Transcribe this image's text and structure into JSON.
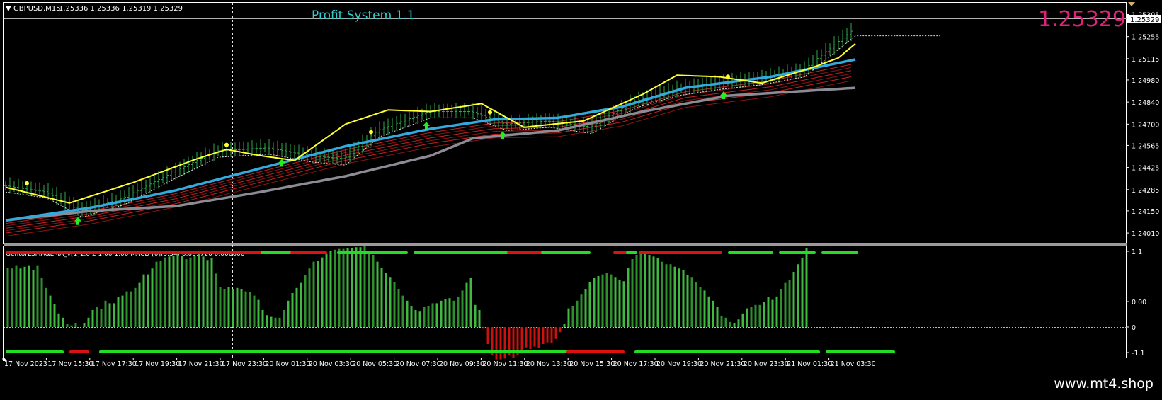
{
  "main_header": {
    "symbol_label": "GBPUSD,M15",
    "ohlc": "1.25336 1.25336 1.25319 1.25329"
  },
  "overlay_title": "Profit System 1.1",
  "big_price": "1.25329",
  "current_price_tag": "1.25329",
  "price_axis_labels": [
    "1.25395",
    "1.25255",
    "1.25115",
    "1.24980",
    "1.24840",
    "1.24700",
    "1.24565",
    "1.24425",
    "1.24285",
    "1.24150",
    "1.24010"
  ],
  "indicator_header": "GentorLSMA&EMA_v[1]1.0.2 1.00 1.00 MACD [0](5,34) 0.001720 0.000000",
  "indicator_axis_labels": [
    "1.1",
    "0.00",
    "0",
    "-1.1"
  ],
  "time_labels": [
    "17 Nov 2023",
    "17 Nov 15:30",
    "17 Nov 17:30",
    "17 Nov 19:30",
    "17 Nov 21:30",
    "17 Nov 23:30",
    "20 Nov 01:30",
    "20 Nov 03:30",
    "20 Nov 05:30",
    "20 Nov 07:30",
    "20 Nov 09:30",
    "20 Nov 11:30",
    "20 Nov 13:30",
    "20 Nov 15:30",
    "20 Nov 17:30",
    "20 Nov 19:30",
    "20 Nov 21:30",
    "20 Nov 23:30",
    "21 Nov 01:30",
    "21 Nov 03:30"
  ],
  "watermark": "www.mt4.shop",
  "colors": {
    "price_bars": "#2fa84f",
    "yellow_line": "#ffff33",
    "blue_line": "#33aadd",
    "slow_line": "#8c8c96",
    "ribbon": "#b42020",
    "arrow": "#22ee22",
    "macd_up": "#3fb93f",
    "macd_down": "#cc1111",
    "title": "#33cccc",
    "big_price": "#e0207a",
    "grid": "#ffffff"
  },
  "chart_data": {
    "type": "line",
    "symbol": "GBPUSD",
    "timeframe": "M15",
    "y_range": [
      1.2397,
      1.2546
    ],
    "bars": 200,
    "price_path": [
      [
        0,
        1.2431
      ],
      [
        10,
        1.2427
      ],
      [
        18,
        1.2415
      ],
      [
        28,
        1.2423
      ],
      [
        38,
        1.2437
      ],
      [
        50,
        1.2453
      ],
      [
        62,
        1.2455
      ],
      [
        72,
        1.245
      ],
      [
        80,
        1.2448
      ],
      [
        88,
        1.2466
      ],
      [
        100,
        1.2478
      ],
      [
        110,
        1.2478
      ],
      [
        118,
        1.247
      ],
      [
        128,
        1.2472
      ],
      [
        138,
        1.2468
      ],
      [
        148,
        1.2484
      ],
      [
        158,
        1.2492
      ],
      [
        168,
        1.2496
      ],
      [
        178,
        1.2499
      ],
      [
        188,
        1.2504
      ],
      [
        200,
        1.253
      ]
    ],
    "series": [
      {
        "name": "",
        "role": "fast",
        "values": [
          [
            0,
            1.243
          ],
          [
            15,
            1.242
          ],
          [
            30,
            1.2433
          ],
          [
            45,
            1.2448
          ],
          [
            52,
            1.2454
          ],
          [
            60,
            1.245
          ],
          [
            68,
            1.2447
          ],
          [
            80,
            1.247
          ],
          [
            90,
            1.2479
          ],
          [
            100,
            1.2478
          ],
          [
            112,
            1.2483
          ],
          [
            122,
            1.2468
          ],
          [
            136,
            1.2472
          ],
          [
            150,
            1.2489
          ],
          [
            158,
            1.2501
          ],
          [
            168,
            1.25
          ],
          [
            178,
            1.2496
          ],
          [
            190,
            1.2506
          ],
          [
            196,
            1.2512
          ],
          [
            200,
            1.2521
          ]
        ]
      },
      {
        "name": "",
        "role": "signal",
        "values": [
          [
            0,
            1.2409
          ],
          [
            20,
            1.2417
          ],
          [
            40,
            1.2428
          ],
          [
            60,
            1.2442
          ],
          [
            80,
            1.2456
          ],
          [
            100,
            1.2467
          ],
          [
            115,
            1.2473
          ],
          [
            130,
            1.2474
          ],
          [
            145,
            1.2481
          ],
          [
            160,
            1.2493
          ],
          [
            180,
            1.25
          ],
          [
            200,
            1.2511
          ]
        ]
      },
      {
        "name": "",
        "role": "slow",
        "values": [
          [
            0,
            1.2409
          ],
          [
            20,
            1.2415
          ],
          [
            40,
            1.2418
          ],
          [
            60,
            1.2427
          ],
          [
            80,
            1.2437
          ],
          [
            100,
            1.245
          ],
          [
            110,
            1.2461
          ],
          [
            130,
            1.2466
          ],
          [
            150,
            1.2478
          ],
          [
            170,
            1.2488
          ],
          [
            200,
            1.2493
          ]
        ]
      }
    ],
    "arrows_up_at_bar": [
      17,
      65,
      99,
      117,
      169
    ],
    "macd_histogram": [
      0.7,
      0.69,
      0.72,
      0.69,
      0.71,
      0.72,
      0.67,
      0.72,
      0.58,
      0.46,
      0.37,
      0.27,
      0.16,
      0.11,
      0.04,
      0.02,
      0.05,
      0.0,
      0.05,
      0.11,
      0.2,
      0.24,
      0.21,
      0.31,
      0.28,
      0.28,
      0.35,
      0.37,
      0.42,
      0.42,
      0.46,
      0.52,
      0.62,
      0.62,
      0.69,
      0.77,
      0.78,
      0.82,
      0.83,
      0.84,
      0.86,
      0.84,
      0.8,
      0.82,
      0.84,
      0.86,
      0.83,
      0.79,
      0.81,
      0.63,
      0.47,
      0.45,
      0.47,
      0.45,
      0.46,
      0.45,
      0.42,
      0.41,
      0.37,
      0.32,
      0.2,
      0.14,
      0.12,
      0.11,
      0.11,
      0.2,
      0.31,
      0.4,
      0.46,
      0.52,
      0.61,
      0.69,
      0.77,
      0.78,
      0.82,
      0.86,
      0.9,
      0.91,
      0.92,
      0.92,
      0.93,
      0.93,
      0.94,
      0.94,
      0.95,
      0.9,
      0.85,
      0.77,
      0.7,
      0.64,
      0.59,
      0.53,
      0.45,
      0.37,
      0.31,
      0.25,
      0.2,
      0.19,
      0.24,
      0.25,
      0.28,
      0.28,
      0.31,
      0.33,
      0.34,
      0.31,
      0.35,
      0.43,
      0.52,
      0.58,
      0.26,
      0.2,
      -0.02,
      -0.2,
      -0.33,
      -0.38,
      -0.38,
      -0.37,
      -0.33,
      -0.36,
      -0.33,
      -0.31,
      -0.24,
      -0.26,
      -0.23,
      -0.25,
      -0.2,
      -0.18,
      -0.19,
      -0.14,
      -0.06,
      0.04,
      0.22,
      0.25,
      0.31,
      0.39,
      0.45,
      0.53,
      0.58,
      0.6,
      0.62,
      0.64,
      0.62,
      0.59,
      0.55,
      0.54,
      0.7,
      0.8,
      0.85,
      0.89,
      0.86,
      0.85,
      0.83,
      0.81,
      0.77,
      0.74,
      0.74,
      0.71,
      0.69,
      0.67,
      0.61,
      0.59,
      0.53,
      0.47,
      0.43,
      0.36,
      0.31,
      0.24,
      0.13,
      0.11,
      0.06,
      0.05,
      0.09,
      0.16,
      0.22,
      0.24,
      0.26,
      0.26,
      0.3,
      0.35,
      0.32,
      0.36,
      0.45,
      0.52,
      0.55,
      0.65,
      0.74,
      0.81,
      0.93
    ],
    "trend_bar_top": [
      [
        0,
        60,
        "down"
      ],
      [
        60,
        64,
        "up"
      ],
      [
        64,
        67,
        "up"
      ],
      [
        67,
        75,
        "down"
      ],
      [
        78,
        94,
        "up"
      ],
      [
        96,
        118,
        "up"
      ],
      [
        118,
        126,
        "down"
      ],
      [
        126,
        137,
        "up"
      ],
      [
        143,
        146,
        "down"
      ],
      [
        146,
        148,
        "up"
      ],
      [
        149,
        168,
        "down"
      ],
      [
        170,
        180,
        "up"
      ],
      [
        182,
        190,
        "up"
      ],
      [
        192,
        200,
        "up"
      ]
    ],
    "trend_bar_bottom": [
      [
        0,
        13,
        "up"
      ],
      [
        15,
        19,
        "down"
      ],
      [
        22,
        132,
        "up"
      ],
      [
        132,
        145,
        "down"
      ],
      [
        148,
        191,
        "up"
      ],
      [
        193,
        218,
        "up"
      ]
    ],
    "x_ticks": [
      "17 Nov 2023",
      "17 Nov 15:30",
      "17 Nov 17:30",
      "17 Nov 19:30",
      "17 Nov 21:30",
      "17 Nov 23:30",
      "20 Nov 01:30",
      "20 Nov 03:30",
      "20 Nov 05:30",
      "20 Nov 07:30",
      "20 Nov 09:30",
      "20 Nov 11:30",
      "20 Nov 13:30",
      "20 Nov 15:30",
      "20 Nov 17:30",
      "20 Nov 19:30",
      "20 Nov 21:30",
      "20 Nov 23:30",
      "21 Nov 01:30",
      "21 Nov 03:30"
    ],
    "y_ticks": [
      1.25395,
      1.25255,
      1.25115,
      1.2498,
      1.2484,
      1.247,
      1.24565,
      1.24425,
      1.24285,
      1.2415,
      1.2401
    ],
    "indicator_y_ticks": [
      "1.1",
      "0.00",
      "0",
      "-1.1"
    ],
    "grid": false,
    "xlabel": "",
    "ylabel": ""
  }
}
